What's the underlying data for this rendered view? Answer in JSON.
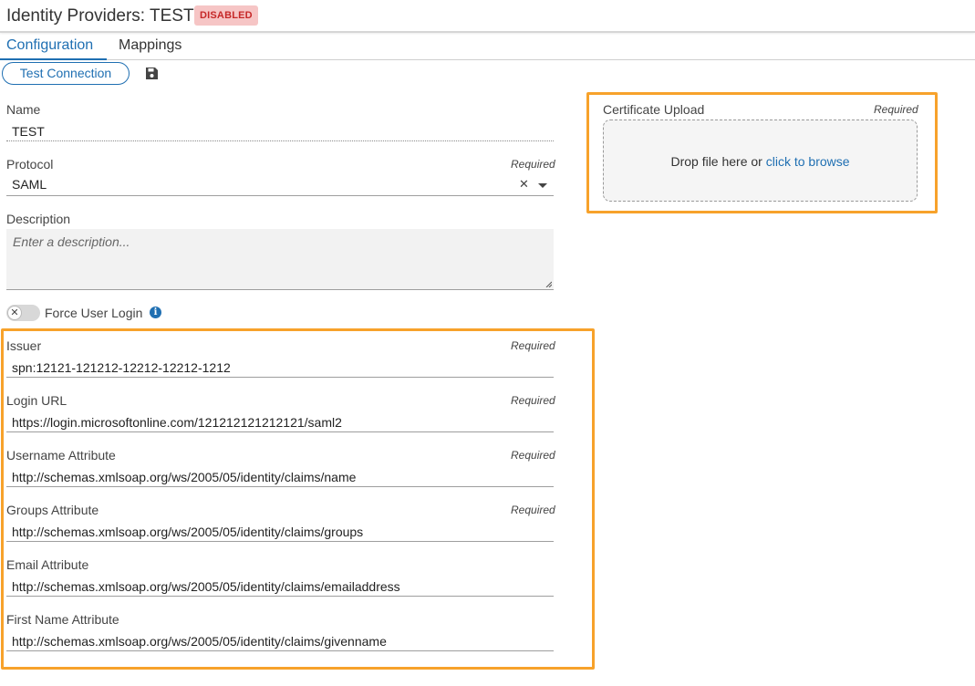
{
  "header": {
    "title": "Identity Providers: TEST",
    "status": "DISABLED"
  },
  "tabs": [
    {
      "label": "Configuration",
      "active": true
    },
    {
      "label": "Mappings",
      "active": false
    }
  ],
  "toolbar": {
    "test_connection_label": "Test Connection",
    "save_icon": "save-icon"
  },
  "form": {
    "name": {
      "label": "Name",
      "value": "TEST"
    },
    "protocol": {
      "label": "Protocol",
      "required": "Required",
      "value": "SAML"
    },
    "description": {
      "label": "Description",
      "placeholder": "Enter a description..."
    },
    "force_user_login": {
      "label": "Force User Login",
      "enabled": false
    },
    "issuer": {
      "label": "Issuer",
      "required": "Required",
      "value": "spn:12121-121212-12212-12212-1212"
    },
    "login_url": {
      "label": "Login URL",
      "required": "Required",
      "value": "https://login.microsoftonline.com/121212121212121/saml2"
    },
    "username_attribute": {
      "label": "Username Attribute",
      "required": "Required",
      "value": "http://schemas.xmlsoap.org/ws/2005/05/identity/claims/name"
    },
    "groups_attribute": {
      "label": "Groups Attribute",
      "required": "Required",
      "value": "http://schemas.xmlsoap.org/ws/2005/05/identity/claims/groups"
    },
    "email_attribute": {
      "label": "Email Attribute",
      "value": "http://schemas.xmlsoap.org/ws/2005/05/identity/claims/emailaddress"
    },
    "first_name_attribute": {
      "label": "First Name Attribute",
      "value": "http://schemas.xmlsoap.org/ws/2005/05/identity/claims/givenname"
    }
  },
  "certificate": {
    "label": "Certificate Upload",
    "required": "Required",
    "drop_text": "Drop file here or ",
    "browse_link": "click to browse"
  },
  "colors": {
    "accent": "#1f6fb2",
    "highlight": "#f7a22b",
    "badge_bg": "#f6c5c5",
    "badge_text": "#c62828"
  }
}
